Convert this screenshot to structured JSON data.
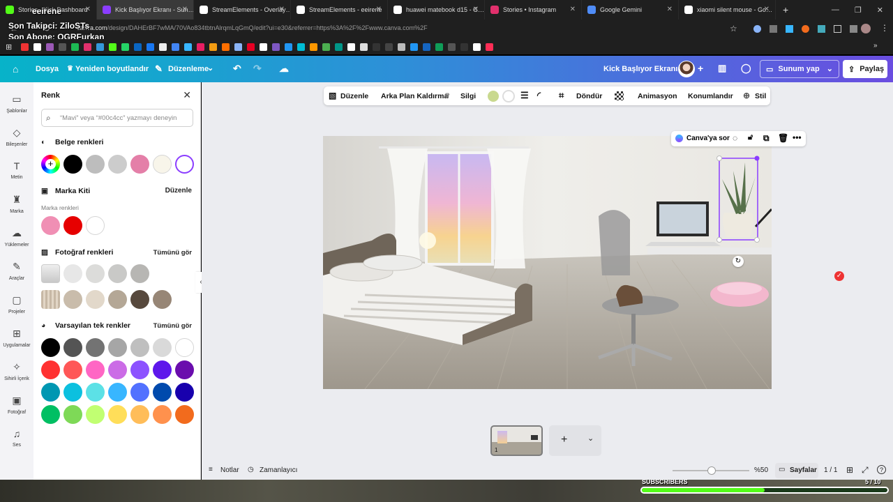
{
  "browser": {
    "tabs": [
      {
        "label": "Stories - Kick Dashboard",
        "color": "#53fc18",
        "active": false
      },
      {
        "label": "Kick Başlıyor Ekranı - Sun…",
        "color": "#8b3dff",
        "active": true
      },
      {
        "label": "StreamElements - Overlay…",
        "color": "#ffffff",
        "active": false
      },
      {
        "label": "StreamElements - eeirene",
        "color": "#ffffff",
        "active": false
      },
      {
        "label": "huawei matebook d15 - G…",
        "color": "#ffffff",
        "active": false
      },
      {
        "label": "Stories • Instagram",
        "color": "#e1306c",
        "active": false
      },
      {
        "label": "Google Gemini",
        "color": "#4f8cf7",
        "active": false
      },
      {
        "label": "xiaomi silent mouse - Go…",
        "color": "#ffffff",
        "active": false
      }
    ],
    "new_tab": "+",
    "url_prefix": "canva.com",
    "url_rest": "/design/DAHErBF7wMA/70VAo834tbtnAlrqmLqGmQ/edit?ui=e30&referrer=https%3A%2F%2Fwww.canva.com%2F"
  },
  "stream_overlay": {
    "channel": "eeirene",
    "follower_line": "Son Takipci: ZiloSTs",
    "sub_line": "Son Abone: OGRFurkan",
    "subscribers_label": "SUBSCRIBERS",
    "subscribers_count": "5 / 10",
    "subscribers_progress": 0.5
  },
  "canva": {
    "menu": {
      "file": "Dosya",
      "resize": "Yeniden boyutlandır",
      "edit": "Düzenleme"
    },
    "doc_title": "Kick Başlıyor Ekranı",
    "present": "Sunum yap",
    "share": "Paylaş",
    "rail": [
      {
        "label": "Şablonlar",
        "icon": "▭"
      },
      {
        "label": "Bileşenler",
        "icon": "◇"
      },
      {
        "label": "Metin",
        "icon": "T"
      },
      {
        "label": "Marka",
        "icon": "♜"
      },
      {
        "label": "Yüklemeler",
        "icon": "☁"
      },
      {
        "label": "Araçlar",
        "icon": "✎"
      },
      {
        "label": "Projeler",
        "icon": "▢"
      },
      {
        "label": "Uygulamalar",
        "icon": "⊞"
      },
      {
        "label": "Sihirli İçerik",
        "icon": "✧"
      },
      {
        "label": "Fotoğraf",
        "icon": "▣"
      },
      {
        "label": "Ses",
        "icon": "♫"
      }
    ],
    "color_panel": {
      "title": "Renk",
      "search_placeholder": "“Mavi” veya “#00c4cc” yazmayı deneyin",
      "document_colors_label": "Belge renkleri",
      "document_colors": [
        "#000000",
        "#bdbdbd",
        "#cccccc",
        "#e47fa8",
        "#f8f5ea",
        "#ffffff"
      ],
      "brand_kit_label": "Marka Kiti",
      "brand_kit_edit": "Düzenle",
      "brand_colors_label": "Marka renkleri",
      "brand_colors": [
        "#f08fb4",
        "#e60000",
        "#ffffff"
      ],
      "photo_colors_label": "Fotoğraf renkleri",
      "photo_colors_see_all": "Tümünü gör",
      "photo_colors_row1": [
        "#e7e7e7",
        "#dcdcda",
        "#c9c9c7",
        "#b7b6b3"
      ],
      "photo_colors_row2": [
        "#c9bcab",
        "#e2d8ca",
        "#b4a796",
        "#57493d",
        "#978676"
      ],
      "default_colors_label": "Varsayılan tek renkler",
      "default_colors_see_all": "Tümünü gör",
      "default_colors": [
        [
          "#000000",
          "#545454",
          "#737373",
          "#a6a6a6",
          "#bfbfbf",
          "#d9d9d9",
          "#ffffff"
        ],
        [
          "#ff3131",
          "#ff5757",
          "#ff66c4",
          "#cb6ce6",
          "#8c52ff",
          "#5e17eb",
          "#6a0dad"
        ],
        [
          "#0097b2",
          "#0cc0df",
          "#5ce1e6",
          "#38b6ff",
          "#5271ff",
          "#004aad",
          "#1800ad"
        ],
        [
          "#00bf63",
          "#7ed957",
          "#c1ff72",
          "#ffde59",
          "#ffbd59",
          "#ff914d",
          "#f26b1d"
        ]
      ]
    },
    "toolbar": {
      "edit": "Düzenle",
      "bg_remove": "Arka Plan Kaldırma",
      "eraser": "Silgi",
      "swatch": "#c9d98f",
      "rotate": "Döndür",
      "animate": "Animasyon",
      "position": "Konumlandır",
      "style": "Stil"
    },
    "ask_canva": "Canva'ya sor",
    "pages": {
      "page_number": "1",
      "add": "+"
    },
    "bottom": {
      "notes": "Notlar",
      "timer": "Zamanlayıcı",
      "zoom": "%50",
      "zoom_level": 0.5,
      "pages_label": "Sayfalar",
      "page_count": "1 / 1"
    }
  }
}
